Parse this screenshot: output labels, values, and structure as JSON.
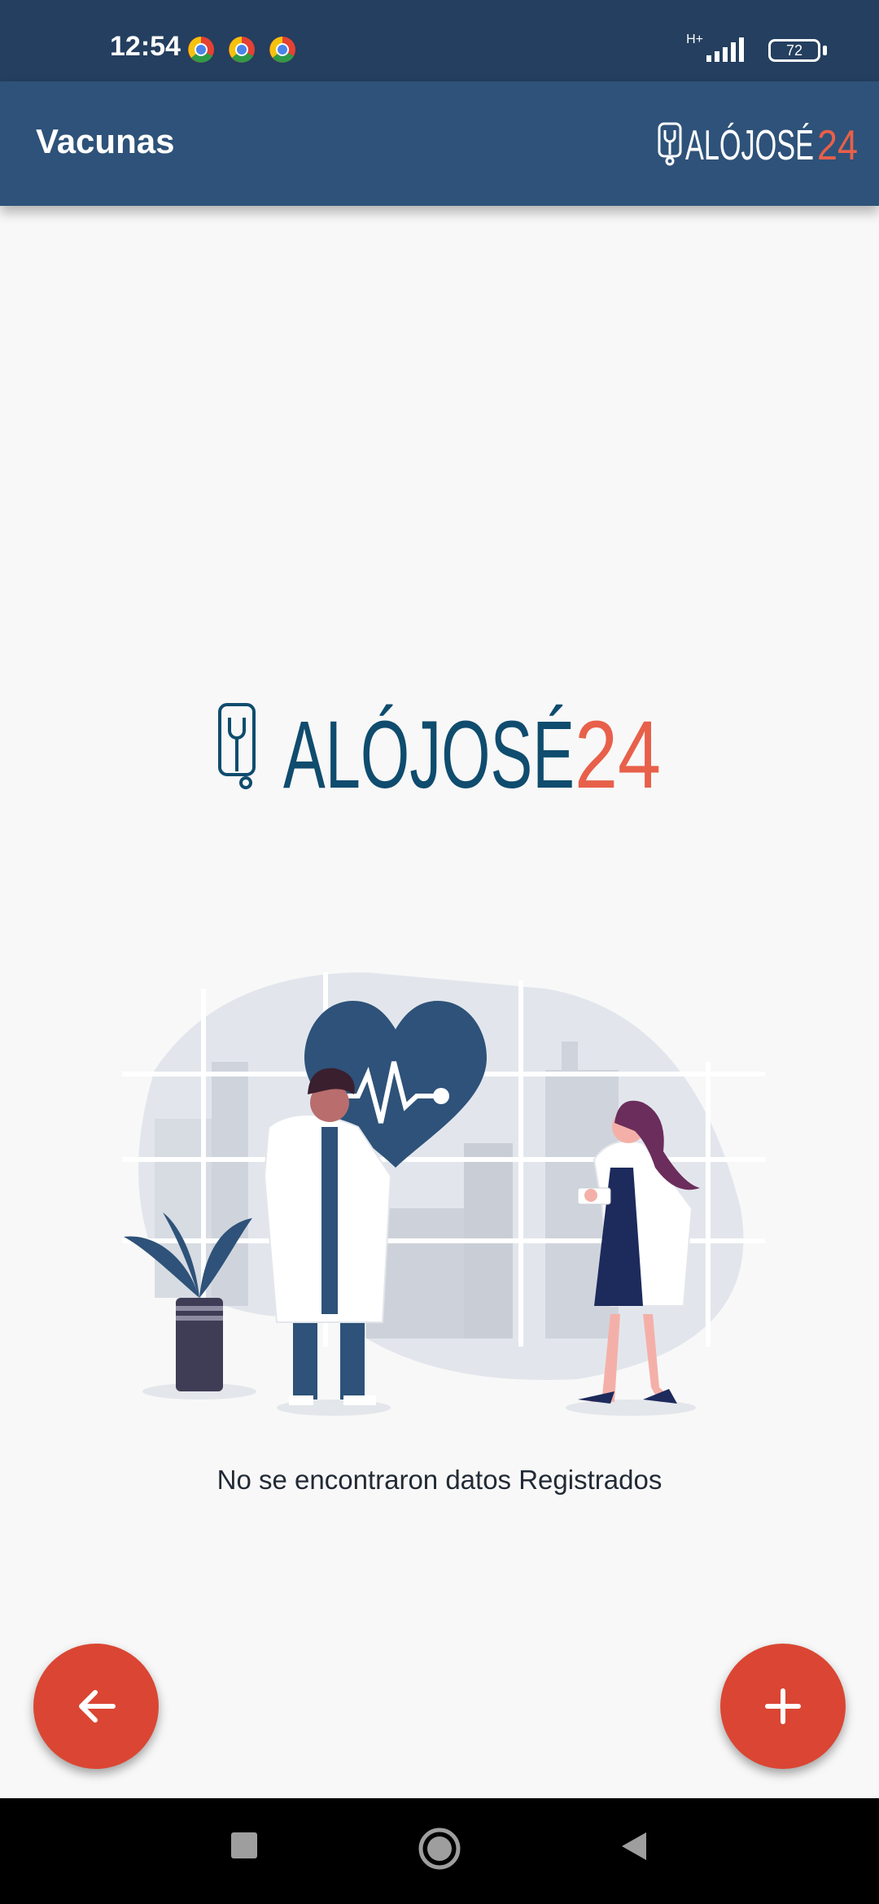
{
  "status": {
    "time": "12:54",
    "network": "H+",
    "battery": "72"
  },
  "app_bar": {
    "title": "Vacunas",
    "logo_text_main": "ALÓJOSÉ",
    "logo_text_num": "24"
  },
  "content": {
    "logo_text_main": "ALÓJOSÉ",
    "logo_text_num": "24",
    "empty_message": "No se encontraron datos Registrados"
  },
  "colors": {
    "status_bar": "#243f5f",
    "app_bar": "#2e5279",
    "brand_blue": "#0f4c6e",
    "brand_orange": "#e8604a",
    "fab": "#da4633"
  },
  "icons": {
    "back": "arrow-left-icon",
    "add": "plus-icon"
  }
}
